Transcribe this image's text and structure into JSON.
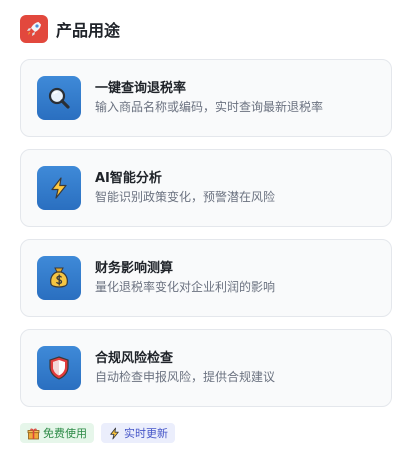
{
  "header": {
    "title": "产品用途",
    "icon": "rocket-icon",
    "icon_bg": "#e2483d"
  },
  "features": [
    {
      "title": "一键查询退税率",
      "description": "输入商品名称或编码，实时查询最新退税率",
      "icon": "magnifier-icon"
    },
    {
      "title": "AI智能分析",
      "description": "智能识别政策变化，预警潜在风险",
      "icon": "lightning-icon"
    },
    {
      "title": "财务影响测算",
      "description": "量化退税率变化对企业利润的影响",
      "icon": "money-bag-icon"
    },
    {
      "title": "合规风险检查",
      "description": "自动检查申报风险，提供合规建议",
      "icon": "shield-icon"
    }
  ],
  "badges": [
    {
      "label": "免费使用",
      "icon": "gift-icon",
      "color": "#2c8a46",
      "bg": "#e6f6ea"
    },
    {
      "label": "实时更新",
      "icon": "lightning-icon",
      "color": "#4656c8",
      "bg": "#ebeefc"
    }
  ],
  "colors": {
    "icon_tile": "#2f7ccc",
    "card_border": "#e4e7ec",
    "card_bg": "#f9fafb"
  }
}
